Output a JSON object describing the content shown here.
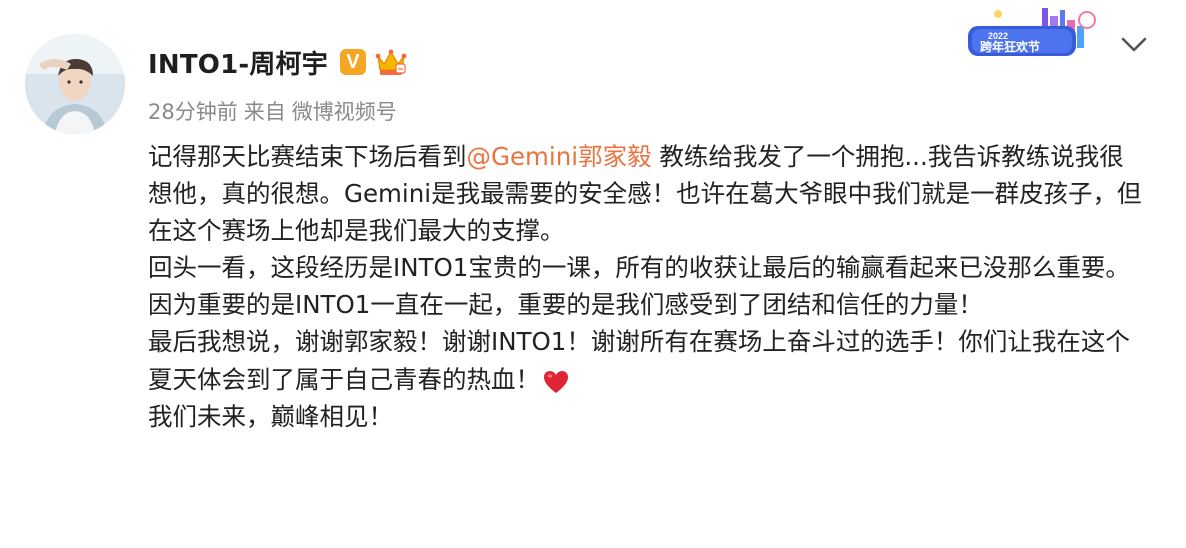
{
  "post": {
    "author_name": "INTO1-周柯宇",
    "verified_badge": "V",
    "crown_badge_icon": "crown-icon",
    "meta": {
      "time": "28分钟前",
      "source_prefix": "来自",
      "source": "微博视频号"
    },
    "festival_badge": {
      "year": "2022",
      "text": "跨年狂欢节"
    },
    "menu_icon": "chevron-down-icon",
    "content": {
      "p1_before": "记得那天比赛结束下场后看到",
      "mention": "@Gemini郭家毅",
      "p1_after": " 教练给我发了一个拥抱...我告诉教练说我很想他，真的很想。Gemini是我最需要的安全感！也许在葛大爷眼中我们就是一群皮孩子，但在这个赛场上他却是我们最大的支撑。",
      "p2": "回头一看，这段经历是INTO1宝贵的一课，所有的收获让最后的输赢看起来已没那么重要。因为重要的是INTO1一直在一起，重要的是我们感受到了团结和信任的力量！",
      "p3_text": "最后我想说，谢谢郭家毅！谢谢INTO1！谢谢所有在赛场上奋斗过的选手！你们让我在这个夏天体会到了属于自己青春的热血！",
      "heart_icon": "heart-icon",
      "p4": "我们未来，巅峰相见！"
    }
  },
  "colors": {
    "mention": "#eb7340",
    "meta": "#8a8a8a",
    "text": "#222222",
    "v_badge": "#f5a623"
  }
}
